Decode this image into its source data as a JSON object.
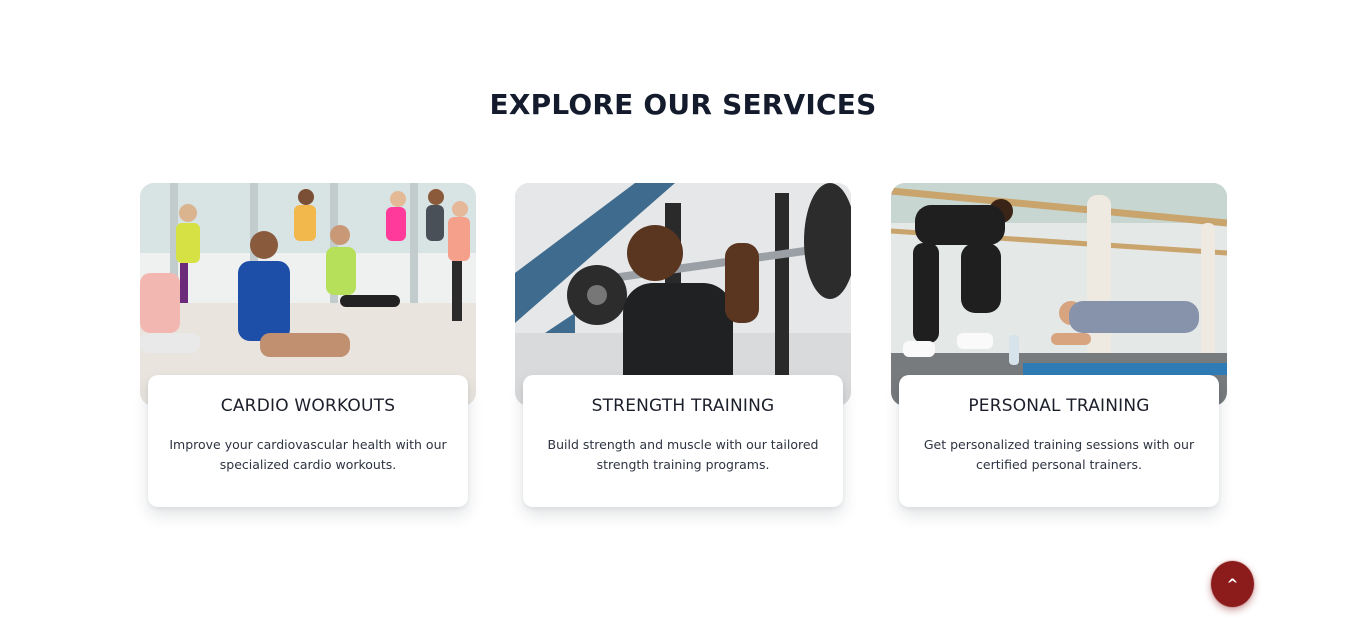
{
  "services": {
    "heading": "EXPLORE OUR SERVICES",
    "cards": [
      {
        "title": "CARDIO WORKOUTS",
        "description_line1": "Improve your cardiovascular health with our",
        "description_line2": "specialized cardio workouts.",
        "image_alt": "group fitness class doing cardio"
      },
      {
        "title": "STRENGTH TRAINING",
        "description_line1": "Build strength and muscle with our tailored",
        "description_line2": "strength training programs.",
        "image_alt": "man lifting barbell"
      },
      {
        "title": "PERSONAL TRAINING",
        "description_line1": "Get personalized training sessions with our",
        "description_line2": "certified personal trainers.",
        "image_alt": "trainer coaching woman in plank"
      }
    ]
  },
  "back_to_top": {
    "label": "^",
    "color": "#8c1c1c"
  }
}
